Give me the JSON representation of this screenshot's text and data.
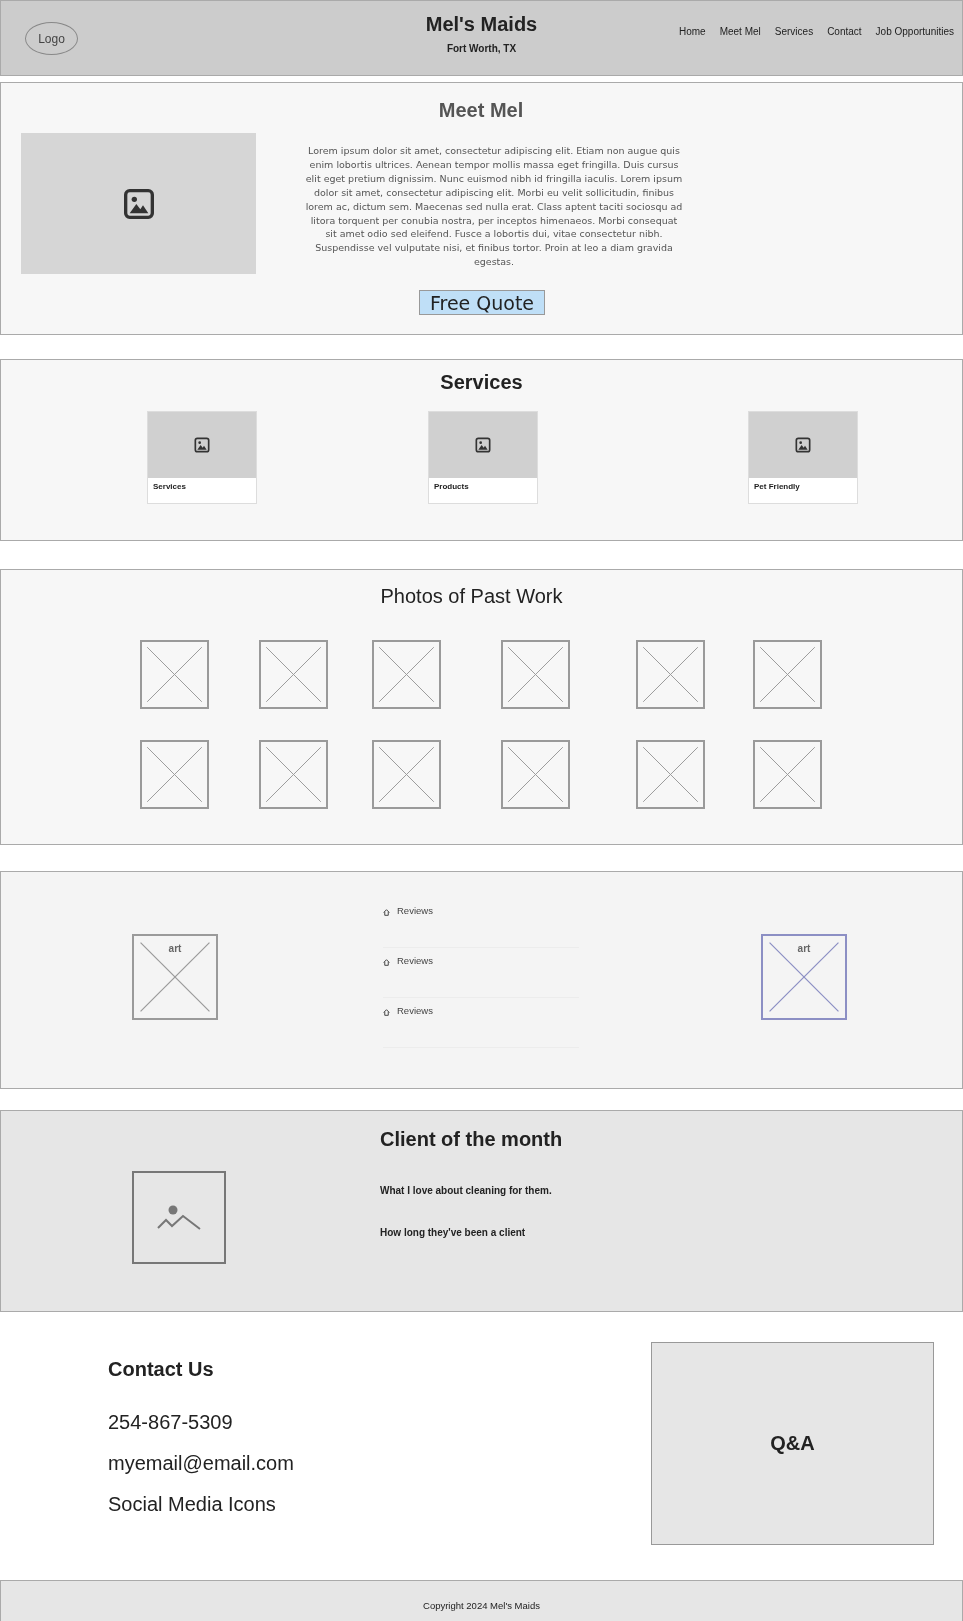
{
  "header": {
    "logo": "Logo",
    "title": "Mel's Maids",
    "subtitle": "Fort Worth, TX",
    "nav": [
      "Home",
      "Meet Mel",
      "Services",
      "Contact",
      "Job Opportunities"
    ]
  },
  "meet": {
    "title": "Meet Mel",
    "body": "Lorem ipsum dolor sit amet, consectetur adipiscing elit. Etiam non augue quis enim lobortis ultrices. Aenean tempor mollis massa eget fringilla. Duis cursus elit eget pretium dignissim. Nunc euismod nibh id fringilla iaculis. Lorem ipsum dolor sit amet, consectetur adipiscing elit. Morbi eu velit sollicitudin, finibus lorem ac, dictum sem. Maecenas sed nulla erat. Class aptent taciti sociosqu ad litora torquent per conubia nostra, per inceptos himenaeos. Morbi consequat sit amet odio sed eleifend. Fusce a lobortis dui, vitae consectetur nibh. Suspendisse vel vulputate nisi, et finibus tortor. Proin at leo a diam gravida egestas.",
    "button": "Free Quote"
  },
  "services": {
    "title": "Services",
    "cards": [
      "Services",
      "Products",
      "Pet Friendly"
    ]
  },
  "photos": {
    "title": "Photos of Past Work"
  },
  "reviews": {
    "art_left": "art",
    "items": [
      "Reviews",
      "Reviews",
      "Reviews"
    ],
    "art_right": "art"
  },
  "client": {
    "title": "Client of the month",
    "lines": [
      "What I love about cleaning for them.",
      "How long they've been a client"
    ]
  },
  "contact": {
    "title": "Contact Us",
    "lines": [
      "254-867-5309",
      "myemail@email.com",
      "Social Media Icons"
    ],
    "qa": "Q&A"
  },
  "footer": "Copyright 2024 Mel's Maids"
}
